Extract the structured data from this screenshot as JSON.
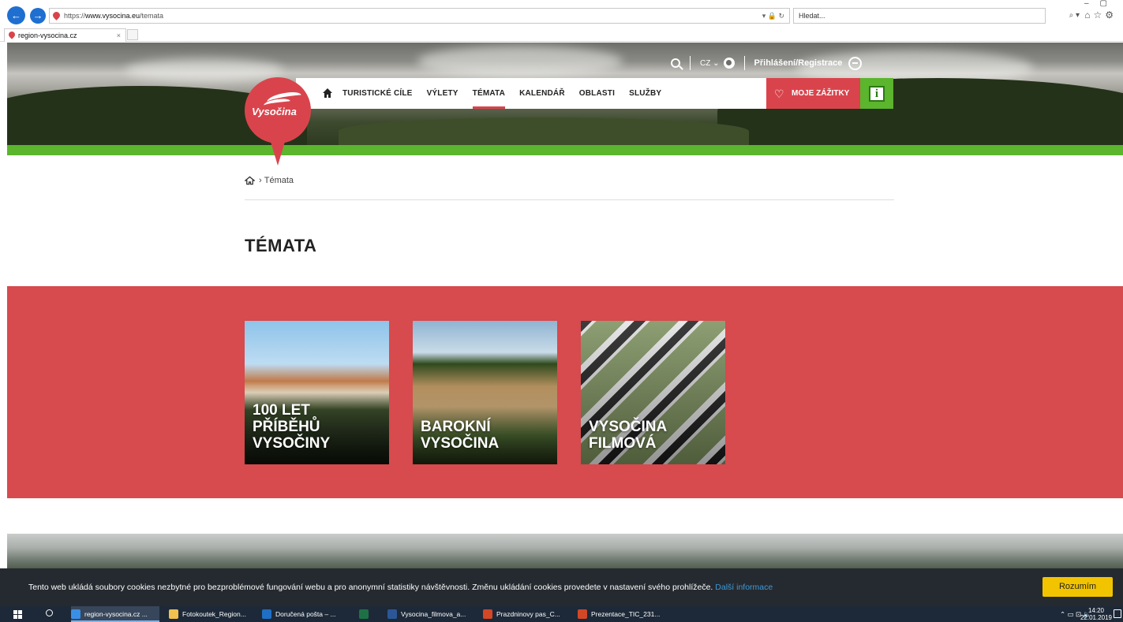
{
  "browser": {
    "url_prefix": "https://",
    "url_host": "www.vysocina.eu",
    "url_path": "/temata",
    "search_placeholder": "Hledat...",
    "tab_title": "region-vysocina.cz",
    "tab_close": "×",
    "back_glyph": "←",
    "forward_glyph": "→"
  },
  "header": {
    "lang": "CZ",
    "login_label": "Přihlášení/Registrace",
    "logo_text": "Vysočina",
    "nav": [
      {
        "label": "TURISTICKÉ CÍLE"
      },
      {
        "label": "VÝLETY"
      },
      {
        "label": "TÉMATA",
        "active": true
      },
      {
        "label": "KALENDÁŘ"
      },
      {
        "label": "OBLASTI"
      },
      {
        "label": "SLUŽBY"
      }
    ],
    "moje_label": "MOJE ZÁŽITKY",
    "info_label": "i"
  },
  "breadcrumb": {
    "current": "Témata"
  },
  "page": {
    "title": "TÉMATA"
  },
  "topics": [
    {
      "lines": [
        "100 LET",
        "PŘÍBĚHŮ",
        "VYSOČINY"
      ]
    },
    {
      "lines": [
        "BAROKNÍ",
        "VYSOČINA"
      ]
    },
    {
      "lines": [
        "VYSOČINA",
        "FILMOVÁ"
      ]
    }
  ],
  "cookie": {
    "text": "Tento web ukládá soubory cookies nezbytné pro bezproblémové fungování webu a pro anonymní statistiky návštěvnosti. Změnu ukládání cookies provedete v nastavení svého prohlížeče.",
    "more_link": "Další informace",
    "accept": "Rozumím"
  },
  "taskbar": {
    "items": [
      {
        "label": "region-vysocina.cz ...",
        "icon": "ie-icon",
        "color": "#3a8ee6"
      },
      {
        "label": "Fotokoutek_Region...",
        "icon": "folder-icon",
        "color": "#f2c14e"
      },
      {
        "label": "Doručená pošta – ...",
        "icon": "outlook-icon",
        "color": "#1f6fc5"
      },
      {
        "label": "",
        "icon": "excel-icon",
        "color": "#1e7145"
      },
      {
        "label": "Vysocina_filmova_a...",
        "icon": "word-icon",
        "color": "#2b5797"
      },
      {
        "label": "Prazdninovy pas_C...",
        "icon": "powerpoint-icon",
        "color": "#d24726"
      },
      {
        "label": "Prezentace_TIC_231...",
        "icon": "powerpoint-icon",
        "color": "#d24726"
      }
    ],
    "time": "14:20",
    "date": "22.01.2019"
  },
  "colors": {
    "brand_red": "#d9444c",
    "brand_green": "#5bb52d",
    "cookie_button": "#f2c400",
    "link_blue": "#3d9ad6"
  }
}
